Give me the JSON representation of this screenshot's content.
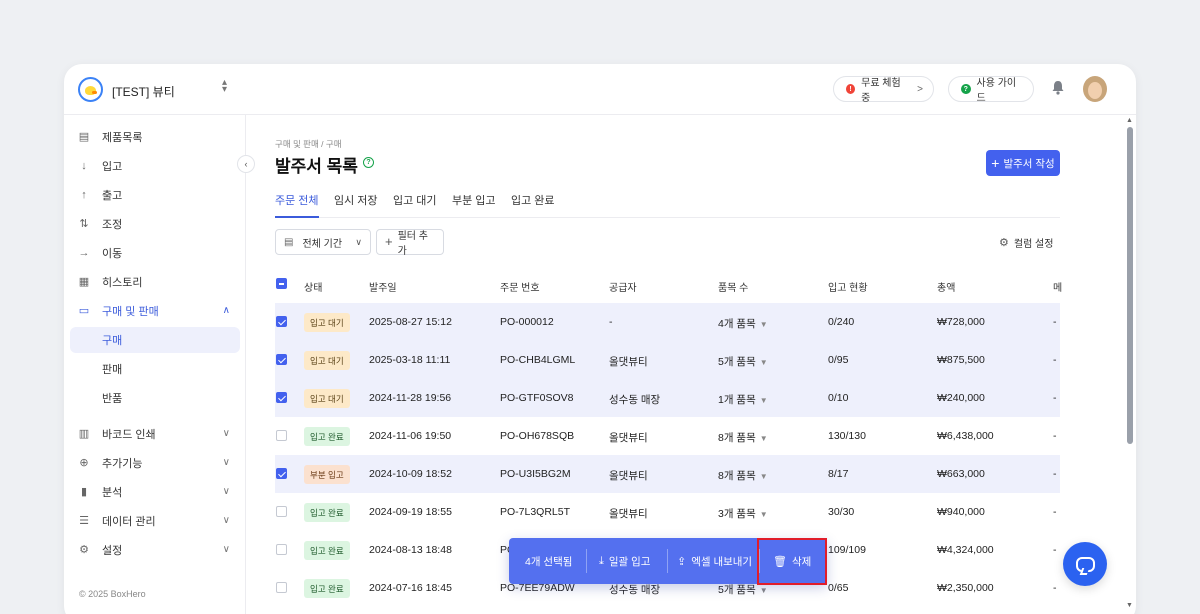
{
  "workspace": {
    "name": "[TEST] 뷰티",
    "switch_icon": "up-down-chevron-icon"
  },
  "header": {
    "trial": {
      "label": "무료 체험 중",
      "icon": "alert-icon",
      "icon_char": "!",
      "chevron": ">"
    },
    "guide": {
      "label": "사용 가이드",
      "icon": "help-icon",
      "icon_char": "?"
    }
  },
  "sidebar": {
    "items": [
      {
        "label": "제품목록",
        "icon": "calendar-icon",
        "glyph": "▤"
      },
      {
        "label": "입고",
        "icon": "arrow-down-icon",
        "glyph": "↓"
      },
      {
        "label": "출고",
        "icon": "arrow-up-icon",
        "glyph": "↑"
      },
      {
        "label": "조정",
        "icon": "swap-icon",
        "glyph": "⇅"
      },
      {
        "label": "이동",
        "icon": "arrow-right-icon",
        "glyph": "→"
      },
      {
        "label": "히스토리",
        "icon": "history-icon",
        "glyph": "▦"
      },
      {
        "label": "구매 및 판매",
        "icon": "receipt-icon",
        "glyph": "▭",
        "caret": "∧"
      }
    ],
    "sub_items": [
      {
        "label": "구매"
      },
      {
        "label": "판매"
      },
      {
        "label": "반품"
      }
    ],
    "bottom_items": [
      {
        "label": "바코드 인쇄",
        "icon": "barcode-icon",
        "glyph": "▥",
        "caret": "∨"
      },
      {
        "label": "추가기능",
        "icon": "plus-circle-icon",
        "glyph": "⊕",
        "caret": "∨"
      },
      {
        "label": "분석",
        "icon": "bar-chart-icon",
        "glyph": "▮",
        "caret": "∨"
      },
      {
        "label": "데이터 관리",
        "icon": "database-icon",
        "glyph": "☰",
        "caret": "∨"
      },
      {
        "label": "설정",
        "icon": "gear-icon",
        "glyph": "⚙",
        "caret": "∨"
      }
    ],
    "collapse": "‹",
    "copyright": "© 2025 BoxHero"
  },
  "page": {
    "breadcrumb": "구매 및 판매 / 구매",
    "title": "발주서 목록",
    "help": "?",
    "create_button": "발주서 작성",
    "create_plus": "+"
  },
  "tabs": [
    {
      "label": "주문 전체"
    },
    {
      "label": "임시 저장"
    },
    {
      "label": "입고 대기"
    },
    {
      "label": "부분 입고"
    },
    {
      "label": "입고 완료"
    }
  ],
  "filters": {
    "date_label": "전체 기간",
    "date_dropdown": "∨",
    "add_label": "필터 추가",
    "add_plus": "+",
    "column_settings": "컬럼 설정"
  },
  "table": {
    "columns": [
      "상태",
      "발주일",
      "주문 번호",
      "공급자",
      "품목 수",
      "입고 현황",
      "총액",
      "메"
    ],
    "rows": [
      {
        "selected": true,
        "status": "입고 대기",
        "status_kind": "wait",
        "date": "2025-08-27 15:12",
        "order_no": "PO-000012",
        "supplier": "-",
        "items": "4개 품목",
        "receipt": "0/240",
        "total": "₩728,000",
        "memo": "-"
      },
      {
        "selected": true,
        "status": "입고 대기",
        "status_kind": "wait",
        "date": "2025-03-18 11:11",
        "order_no": "PO-CHB4LGML",
        "supplier": "올댓뷰티",
        "items": "5개 품목",
        "receipt": "0/95",
        "total": "₩875,500",
        "memo": "-"
      },
      {
        "selected": true,
        "status": "입고 대기",
        "status_kind": "wait",
        "date": "2024-11-28 19:56",
        "order_no": "PO-GTF0SOV8",
        "supplier": "성수동 매장",
        "items": "1개 품목",
        "receipt": "0/10",
        "total": "₩240,000",
        "memo": "-"
      },
      {
        "selected": false,
        "status": "입고 완료",
        "status_kind": "done",
        "date": "2024-11-06 19:50",
        "order_no": "PO-OH678SQB",
        "supplier": "올댓뷰티",
        "items": "8개 품목",
        "receipt": "130/130",
        "total": "₩6,438,000",
        "memo": "-"
      },
      {
        "selected": true,
        "status": "부분 입고",
        "status_kind": "partial",
        "date": "2024-10-09 18:52",
        "order_no": "PO-U3I5BG2M",
        "supplier": "올댓뷰티",
        "items": "8개 품목",
        "receipt": "8/17",
        "total": "₩663,000",
        "memo": "-"
      },
      {
        "selected": false,
        "status": "입고 완료",
        "status_kind": "done",
        "date": "2024-09-19 18:55",
        "order_no": "PO-7L3QRL5T",
        "supplier": "올댓뷰티",
        "items": "3개 품목",
        "receipt": "30/30",
        "total": "₩940,000",
        "memo": "-"
      },
      {
        "selected": false,
        "status": "입고 완료",
        "status_kind": "done",
        "date": "2024-08-13 18:48",
        "order_no": "PO",
        "supplier": "",
        "items": "",
        "receipt": "109/109",
        "total": "₩4,324,000",
        "memo": "-"
      },
      {
        "selected": false,
        "status": "입고 완료",
        "status_kind": "done",
        "date": "2024-07-16 18:45",
        "order_no": "PO-7EE79ADW",
        "supplier": "성수동 매장",
        "items": "5개 품목",
        "receipt": "0/65",
        "total": "₩2,350,000",
        "memo": "-"
      }
    ]
  },
  "bulk_bar": {
    "selected_count": "4개 선택됨",
    "bulk_receive": "일괄 입고",
    "excel_export": "엑셀 내보내기",
    "delete": "삭제"
  },
  "colors": {
    "accent": "#4361ee",
    "highlight": "#e11d2a",
    "selected_row": "#eef0fc"
  }
}
